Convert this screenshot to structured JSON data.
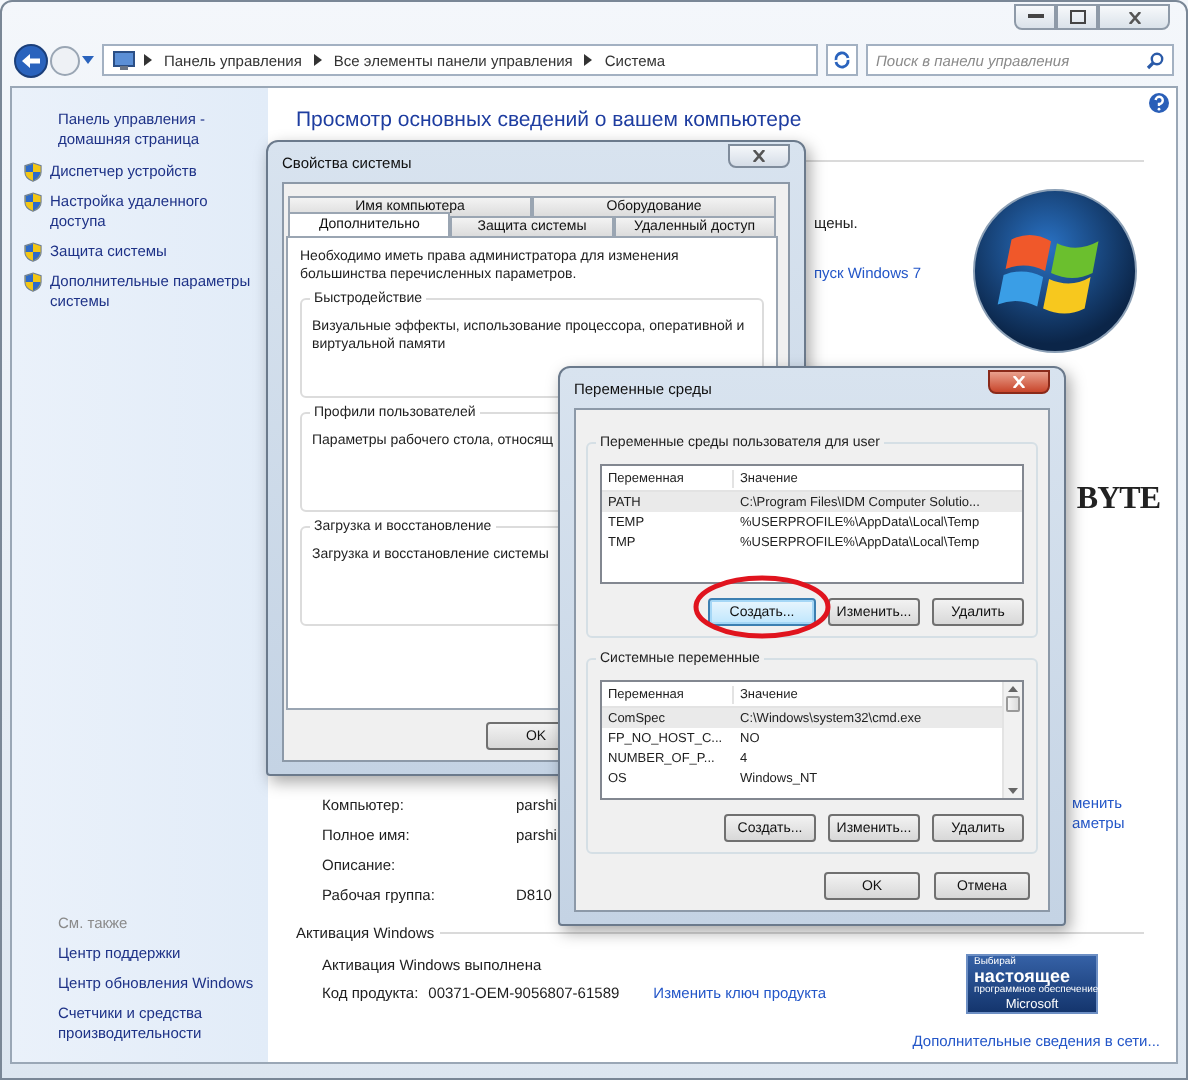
{
  "window": {
    "breadcrumb": [
      "Панель управления",
      "Все элементы панели управления",
      "Система"
    ],
    "search": {
      "placeholder": "Поиск в панели управления"
    }
  },
  "sidebar": {
    "home_link": "Панель управления - домашняя страница",
    "items": [
      "Диспетчер устройств",
      "Настройка удаленного доступа",
      "Защита системы",
      "Дополнительные параметры системы"
    ],
    "see_also_title": "См. также",
    "see_also": [
      "Центр поддержки",
      "Центр обновления Windows",
      "Счетчики и средства производительности"
    ]
  },
  "main": {
    "heading": "Просмотр основных сведений о вашем компьютере",
    "fragments": [
      {
        "kind": "text",
        "text": "щены."
      },
      {
        "kind": "link",
        "text": "пуск Windows 7"
      }
    ],
    "brand": "BYTE",
    "side_links": [
      "менить",
      "аметры"
    ],
    "computer_rows": [
      {
        "label": "Компьютер:",
        "value": "parshi"
      },
      {
        "label": "Полное имя:",
        "value": "parshi"
      },
      {
        "label": "Описание:"
      },
      {
        "label": "Рабочая группа:",
        "value": "D810"
      }
    ],
    "activation_title": "Активация Windows",
    "activation_status": "Активация Windows выполнена",
    "product_key_label": "Код продукта:",
    "product_key": "00371-OEM-9056807-61589",
    "change_key_link": "Изменить ключ продукта",
    "badge": [
      "Выбирай",
      "настоящее",
      "программное обеспечение",
      "Microsoft"
    ],
    "more_info_link": "Дополнительные сведения в сети..."
  },
  "system_properties": {
    "title": "Свойства системы",
    "tab_rows": [
      [
        {
          "label": "Имя компьютера",
          "selected": false
        },
        {
          "label": "Оборудование",
          "selected": false
        }
      ],
      [
        {
          "label": "Дополнительно",
          "selected": true
        },
        {
          "label": "Защита системы",
          "selected": false
        },
        {
          "label": "Удаленный доступ",
          "selected": false
        }
      ]
    ],
    "note": "Необходимо иметь права администратора для изменения большинства перечисленных параметров.",
    "groups": [
      {
        "title": "Быстродействие",
        "text": "Визуальные эффекты, использование процессора, оперативной и виртуальной памяти"
      },
      {
        "title": "Профили пользователей",
        "text": "Параметры рабочего стола, относящ"
      },
      {
        "title": "Загрузка и восстановление",
        "text": "Загрузка и восстановление системы"
      }
    ],
    "ok": "OK"
  },
  "env_dialog": {
    "title": "Переменные среды",
    "sections": [
      {
        "title": "Переменные среды пользователя для user",
        "scrollbar": false,
        "columns": [
          "Переменная",
          "Значение"
        ],
        "rows": [
          {
            "name": "PATH",
            "value": "C:\\Program Files\\IDM Computer Solutio...",
            "selected": true
          },
          {
            "name": "TEMP",
            "value": "%USERPROFILE%\\AppData\\Local\\Temp",
            "selected": false
          },
          {
            "name": "TMP",
            "value": "%USERPROFILE%\\AppData\\Local\\Temp",
            "selected": false
          }
        ],
        "buttons": [
          {
            "label": "Создать...",
            "focused": true
          },
          {
            "label": "Изменить...",
            "focused": false
          },
          {
            "label": "Удалить",
            "focused": false
          }
        ]
      },
      {
        "title": "Системные переменные",
        "scrollbar": true,
        "columns": [
          "Переменная",
          "Значение"
        ],
        "rows": [
          {
            "name": "ComSpec",
            "value": "C:\\Windows\\system32\\cmd.exe",
            "selected": true
          },
          {
            "name": "FP_NO_HOST_C...",
            "value": "NO",
            "selected": false
          },
          {
            "name": "NUMBER_OF_P...",
            "value": "4",
            "selected": false
          },
          {
            "name": "OS",
            "value": "Windows_NT",
            "selected": false
          }
        ],
        "buttons": [
          {
            "label": "Создать...",
            "focused": false
          },
          {
            "label": "Изменить...",
            "focused": false
          },
          {
            "label": "Удалить",
            "focused": false
          }
        ]
      }
    ],
    "ok": "OK",
    "cancel": "Отмена"
  }
}
